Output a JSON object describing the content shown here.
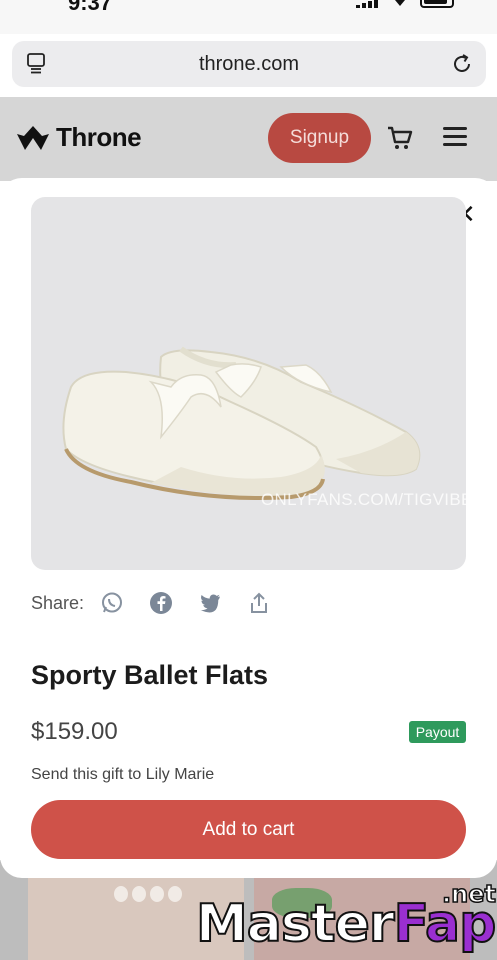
{
  "status_bar": {
    "time": "9:37"
  },
  "browser": {
    "url": "throne.com"
  },
  "header": {
    "brand": "Throne",
    "signup_label": "Signup"
  },
  "product": {
    "image_alt": "Sporty Ballet Flats product photo",
    "image_watermark": "ONLYFANS.COM/TIGVIBES",
    "share_label": "Share:",
    "share_icons": [
      "whatsapp-icon",
      "facebook-icon",
      "twitter-icon",
      "share-upload-icon"
    ],
    "title": "Sporty Ballet Flats",
    "price": "$159.00",
    "badge": "Payout",
    "gift_text": "Send this gift to Lily Marie",
    "add_to_cart_label": "Add to cart"
  },
  "overlay_watermark": {
    "left_part": "Master",
    "right_part": "Fap",
    "suffix": ".net"
  },
  "colors": {
    "accent": "#cf5249",
    "signup": "#b84941",
    "badge": "#2e9a5c",
    "header_bg": "#d6d6d6"
  }
}
